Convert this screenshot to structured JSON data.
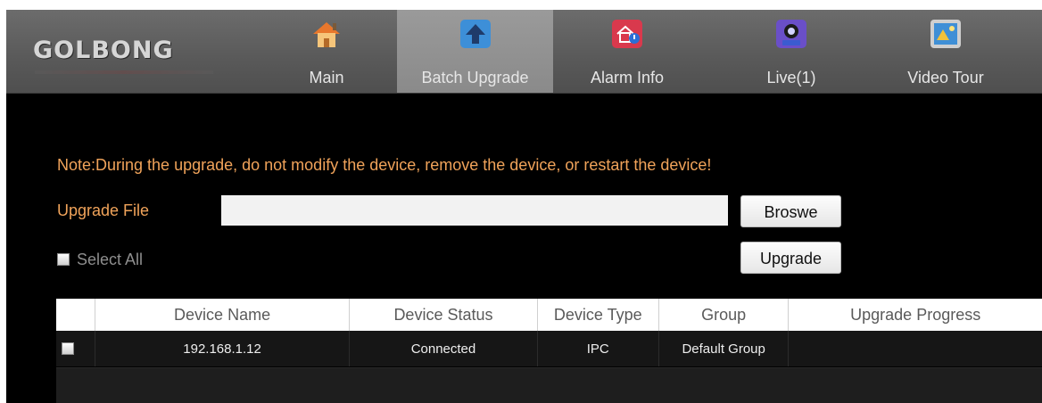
{
  "brand": {
    "logo_text": "GOLBONG"
  },
  "nav": [
    {
      "label": "Main",
      "icon": "house-icon",
      "active": false
    },
    {
      "label": "Batch Upgrade",
      "icon": "upload-arrow-icon",
      "active": true
    },
    {
      "label": "Alarm Info",
      "icon": "alarm-house-icon",
      "active": false
    },
    {
      "label": "Live(1)",
      "icon": "live-camera-icon",
      "active": false
    },
    {
      "label": "Video Tour",
      "icon": "video-tour-icon",
      "active": false
    }
  ],
  "upgrade": {
    "note": "Note:During the upgrade, do not modify the device, remove the device, or restart the device!",
    "file_label": "Upgrade File",
    "file_value": "",
    "browse_label": "Broswe",
    "upgrade_label": "Upgrade",
    "select_all_label": "Select All"
  },
  "table": {
    "columns": [
      "",
      "Device Name",
      "Device Status",
      "Device Type",
      "Group",
      "Upgrade Progress"
    ],
    "rows": [
      {
        "device_name": "192.168.1.12",
        "status": "Connected",
        "type": "IPC",
        "group": "Default Group",
        "progress": ""
      }
    ]
  },
  "colors": {
    "note": "#f0a35a",
    "topbar": "#5c5c5c",
    "active_tab": "#8f8f8f",
    "background": "#000000"
  }
}
